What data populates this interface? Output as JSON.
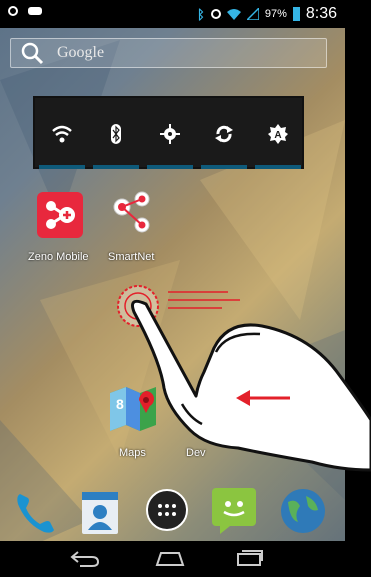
{
  "status": {
    "battery": "97%",
    "time": "8:36"
  },
  "search": {
    "placeholder": "Google",
    "icon": "search-icon"
  },
  "quick_settings": [
    {
      "name": "wifi-icon"
    },
    {
      "name": "bluetooth-icon"
    },
    {
      "name": "gps-icon"
    },
    {
      "name": "sync-icon"
    },
    {
      "name": "auto-brightness-icon"
    }
  ],
  "apps": [
    {
      "label": "Zeno Mobile",
      "color": "#e8283d"
    },
    {
      "label": "SmartNet",
      "color": "#ffffff"
    },
    {
      "label": "Maps",
      "color": "#3ba34a"
    },
    {
      "label": "Dev",
      "color": "#ffffff"
    }
  ],
  "dock": [
    {
      "name": "phone-icon",
      "color": "#1a93d1"
    },
    {
      "name": "contacts-icon",
      "color": "#2d7fc2"
    },
    {
      "name": "app-drawer-icon",
      "color": "#ffffff"
    },
    {
      "name": "messaging-icon",
      "color": "#8bc540"
    },
    {
      "name": "browser-icon",
      "color": "#2f7ab8"
    }
  ],
  "nav": [
    "back-icon",
    "home-icon",
    "recents-icon"
  ],
  "gesture": {
    "direction": "left",
    "arrow_color": "#e3202a"
  }
}
